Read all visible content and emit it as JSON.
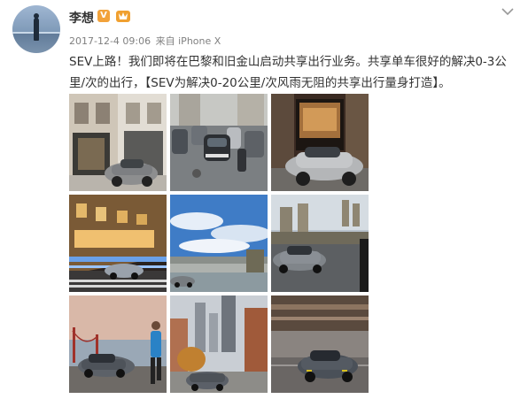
{
  "post": {
    "username": "李想",
    "vip_badge": "V",
    "time": "2017-12-4 09:06",
    "source_prefix": "来自",
    "source": "iPhone X",
    "text": "SEV上路！我们即将在巴黎和旧金山启动共享出行业务。共享单车很好的解决0-3公里/次的出行，【SEV为解决0-20公里/次风雨无阻的共享出行量身打造】。"
  },
  "icons": {
    "vip": "verified-badge-icon",
    "level": "level-badge-icon",
    "menu": "chevron-down-icon"
  },
  "colors": {
    "name": "#333333",
    "meta": "#808080",
    "vip": "#f2a23a",
    "level": "#f0a030"
  },
  "photos": [
    {
      "scene": "paris-boutique-street"
    },
    {
      "scene": "paris-cobblestone-parking"
    },
    {
      "scene": "paris-storefront-night"
    },
    {
      "scene": "paris-arcade-night"
    },
    {
      "scene": "seine-bridge-sky"
    },
    {
      "scene": "notre-dame-embankment"
    },
    {
      "scene": "golden-gate-runner"
    },
    {
      "scene": "san-francisco-hill"
    },
    {
      "scene": "motion-blur-street"
    }
  ]
}
